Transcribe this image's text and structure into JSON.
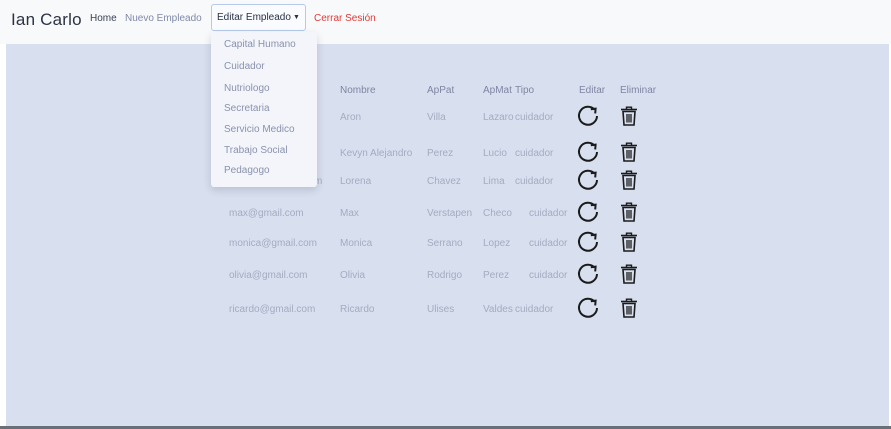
{
  "navbar": {
    "brand": "Ian Carlo",
    "home": "Home",
    "nuevo_empleado": "Nuevo Empleado",
    "editar_empleado": "Editar Empleado",
    "cerrar_sesion": "Cerrar Sesión"
  },
  "dropdown": {
    "items": [
      "Capital Humano",
      "Cuidador",
      "Nutriologo",
      "Secretaria",
      "Servicio Medico",
      "Trabajo Social",
      "Pedagogo"
    ]
  },
  "table": {
    "headers": {
      "correo": "",
      "nombre": "Nombre",
      "appat": "ApPat",
      "apmat": "ApMat",
      "tipo": "Tipo",
      "editar": "Editar",
      "eliminar": "Eliminar"
    },
    "rows": [
      {
        "correo": "",
        "nombre": "Aron",
        "appat": "Villa",
        "apmat": "Lazaro",
        "tipo": "cuidador"
      },
      {
        "correo": "",
        "nombre": "Kevyn Alejandro",
        "appat": "Perez",
        "apmat": "Lucio",
        "tipo": "cuidador"
      },
      {
        "correo": "m",
        "nombre": "Lorena",
        "appat": "Chavez",
        "apmat": "Lima",
        "tipo": "cuidador"
      },
      {
        "correo": "max@gmail.com",
        "nombre": "Max",
        "appat": "Verstapen",
        "apmat": "Checo",
        "tipo": "cuidador"
      },
      {
        "correo": "monica@gmail.com",
        "nombre": "Monica",
        "appat": "Serrano",
        "apmat": "Lopez",
        "tipo": "cuidador"
      },
      {
        "correo": "olivia@gmail.com",
        "nombre": "Olivia",
        "appat": "Rodrigo",
        "apmat": "Perez",
        "tipo": "cuidador"
      },
      {
        "correo": "ricardo@gmail.com",
        "nombre": "Ricardo",
        "appat": "Ulises",
        "apmat": "Valdes",
        "tipo": "cuidador"
      }
    ],
    "edit_icon": "refresh-icon",
    "delete_icon": "trash-icon"
  },
  "colors": {
    "navbar_bg": "#f8f9fb",
    "content_bg": "#d8dfee",
    "logout": "#e53935",
    "text_muted": "#a6abc2"
  }
}
